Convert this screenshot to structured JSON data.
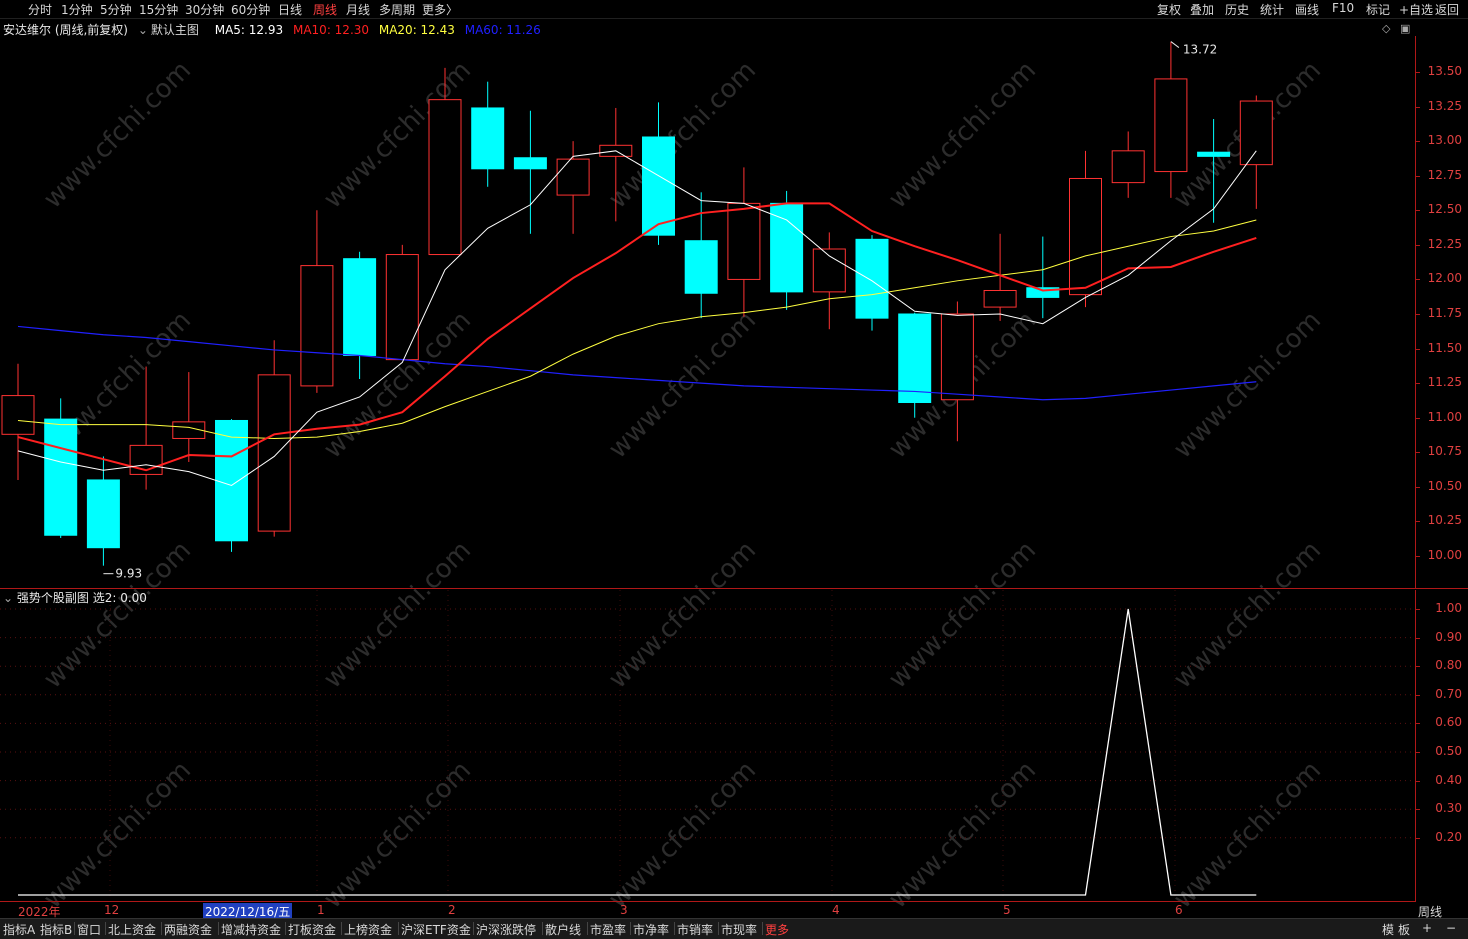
{
  "toolbar": {
    "periods": [
      "分时",
      "1分钟",
      "5分钟",
      "15分钟",
      "30分钟",
      "60分钟",
      "日线",
      "周线",
      "月线",
      "多周期",
      "更多〉"
    ],
    "active": "周线",
    "right_items": [
      "复权",
      "叠加",
      "历史",
      "统计",
      "画线",
      "F10",
      "标记",
      "+自选",
      "返回"
    ]
  },
  "info": {
    "stock": "安达维尔 (周线,前复权)",
    "main_chart": "默认主图",
    "ma5": "MA5: 12.93",
    "ma10": "MA10: 12.30",
    "ma20": "MA20: 12.43",
    "ma60": "MA60: 11.26",
    "colors": {
      "ma5": "#ffffff",
      "ma10": "#ff2020",
      "ma20": "#ffff40",
      "ma60": "#2020ff",
      "up": "#ff3232",
      "down": "#00ffff"
    }
  },
  "osc": {
    "title": "强势个股副图",
    "value": "选2: 0.00"
  },
  "annotations": {
    "high": "13.72",
    "low": "9.93"
  },
  "time_axis": {
    "labels": [
      "2022年",
      "12",
      "2022/12/16/五",
      "1",
      "2",
      "3",
      "4",
      "5",
      "6"
    ],
    "period": "周线"
  },
  "bottom": {
    "tabs": [
      "指标A",
      "指标B",
      "窗口",
      "北上资金",
      "两融资金",
      "增减持资金",
      "打板资金",
      "上榜资金",
      "沪深ETF资金",
      "沪深涨跌停",
      "散户线",
      "市盈率",
      "市净率",
      "市销率",
      "市现率",
      "更多"
    ],
    "right": [
      "模",
      "板",
      "+",
      "−"
    ]
  },
  "watermark": "www.cfchi.com",
  "chart_data": {
    "type": "candlestick",
    "price_axis": {
      "ticks": [
        "13.50",
        "13.25",
        "13.00",
        "12.75",
        "12.50",
        "12.25",
        "12.00",
        "11.75",
        "11.50",
        "11.25",
        "11.00",
        "10.75",
        "10.50",
        "10.25",
        "10.00"
      ],
      "ylim": [
        9.8,
        13.8
      ]
    },
    "osc_axis": {
      "ticks": [
        "1.00",
        "0.90",
        "0.80",
        "0.70",
        "0.60",
        "0.50",
        "0.40",
        "0.30",
        "0.20"
      ],
      "ylim": [
        0,
        1.0
      ]
    },
    "candles": [
      {
        "o": 10.88,
        "h": 11.39,
        "l": 10.55,
        "c": 11.16
      },
      {
        "o": 10.99,
        "h": 11.14,
        "l": 10.13,
        "c": 10.15
      },
      {
        "o": 10.55,
        "h": 10.72,
        "l": 9.93,
        "c": 10.06
      },
      {
        "o": 10.59,
        "h": 11.37,
        "l": 10.48,
        "c": 10.8
      },
      {
        "o": 10.85,
        "h": 11.33,
        "l": 10.68,
        "c": 10.97
      },
      {
        "o": 10.98,
        "h": 10.99,
        "l": 10.03,
        "c": 10.11
      },
      {
        "o": 10.18,
        "h": 11.56,
        "l": 10.14,
        "c": 11.31
      },
      {
        "o": 11.23,
        "h": 12.5,
        "l": 11.18,
        "c": 12.1
      },
      {
        "o": 12.15,
        "h": 12.2,
        "l": 11.28,
        "c": 11.45
      },
      {
        "o": 11.42,
        "h": 12.25,
        "l": 11.42,
        "c": 12.18
      },
      {
        "o": 12.18,
        "h": 13.53,
        "l": 12.18,
        "c": 13.3
      },
      {
        "o": 13.24,
        "h": 13.43,
        "l": 12.67,
        "c": 12.8
      },
      {
        "o": 12.88,
        "h": 13.22,
        "l": 12.33,
        "c": 12.8
      },
      {
        "o": 12.61,
        "h": 13.0,
        "l": 12.33,
        "c": 12.87
      },
      {
        "o": 12.89,
        "h": 13.24,
        "l": 12.42,
        "c": 12.97
      },
      {
        "o": 13.03,
        "h": 13.28,
        "l": 12.25,
        "c": 12.32
      },
      {
        "o": 12.28,
        "h": 12.63,
        "l": 11.72,
        "c": 11.9
      },
      {
        "o": 12.0,
        "h": 12.81,
        "l": 11.73,
        "c": 12.55
      },
      {
        "o": 12.55,
        "h": 12.64,
        "l": 11.78,
        "c": 11.91
      },
      {
        "o": 11.91,
        "h": 12.34,
        "l": 11.64,
        "c": 12.22
      },
      {
        "o": 12.29,
        "h": 12.32,
        "l": 11.63,
        "c": 11.72
      },
      {
        "o": 11.75,
        "h": 11.76,
        "l": 11.0,
        "c": 11.11
      },
      {
        "o": 11.13,
        "h": 11.84,
        "l": 10.83,
        "c": 11.75
      },
      {
        "o": 11.8,
        "h": 12.33,
        "l": 11.7,
        "c": 11.92
      },
      {
        "o": 11.94,
        "h": 12.31,
        "l": 11.72,
        "c": 11.87
      },
      {
        "o": 11.89,
        "h": 12.93,
        "l": 11.8,
        "c": 12.73
      },
      {
        "o": 12.7,
        "h": 13.07,
        "l": 12.59,
        "c": 12.93
      },
      {
        "o": 12.78,
        "h": 13.72,
        "l": 12.59,
        "c": 13.45
      },
      {
        "o": 12.92,
        "h": 13.16,
        "l": 12.41,
        "c": 12.89
      },
      {
        "o": 12.83,
        "h": 13.33,
        "l": 12.51,
        "c": 13.29
      }
    ],
    "ma5": [
      10.76,
      10.68,
      10.62,
      10.66,
      10.61,
      10.51,
      10.72,
      11.04,
      11.15,
      11.4,
      12.07,
      12.37,
      12.54,
      12.89,
      12.93,
      12.75,
      12.57,
      12.55,
      12.43,
      12.17,
      11.99,
      11.77,
      11.74,
      11.75,
      11.68,
      11.87,
      12.03,
      12.28,
      12.51,
      12.93
    ],
    "ma10": [
      10.86,
      10.78,
      10.7,
      10.62,
      10.73,
      10.72,
      10.88,
      10.92,
      10.95,
      11.04,
      11.3,
      11.57,
      11.79,
      12.01,
      12.19,
      12.4,
      12.48,
      12.51,
      12.55,
      12.55,
      12.35,
      12.24,
      12.14,
      12.03,
      11.92,
      11.94,
      12.08,
      12.09,
      12.2,
      12.3
    ],
    "ma20": [
      10.98,
      10.95,
      10.95,
      10.95,
      10.93,
      10.86,
      10.85,
      10.86,
      10.9,
      10.96,
      11.08,
      11.19,
      11.3,
      11.46,
      11.59,
      11.68,
      11.73,
      11.76,
      11.8,
      11.86,
      11.89,
      11.94,
      11.99,
      12.03,
      12.07,
      12.17,
      12.24,
      12.31,
      12.35,
      12.43
    ],
    "ma60": [
      11.66,
      11.63,
      11.6,
      11.58,
      11.55,
      11.52,
      11.49,
      11.47,
      11.45,
      11.42,
      11.39,
      11.37,
      11.34,
      11.31,
      11.29,
      11.27,
      11.25,
      11.23,
      11.22,
      11.21,
      11.2,
      11.19,
      11.17,
      11.15,
      11.13,
      11.14,
      11.17,
      11.2,
      11.23,
      11.26
    ],
    "osc_series": [
      0,
      0,
      0,
      0,
      0,
      0,
      0,
      0,
      0,
      0,
      0,
      0,
      0,
      0,
      0,
      0,
      0,
      0,
      0,
      0,
      0,
      0,
      0,
      0,
      0,
      0,
      1.0,
      0,
      0,
      0
    ]
  }
}
